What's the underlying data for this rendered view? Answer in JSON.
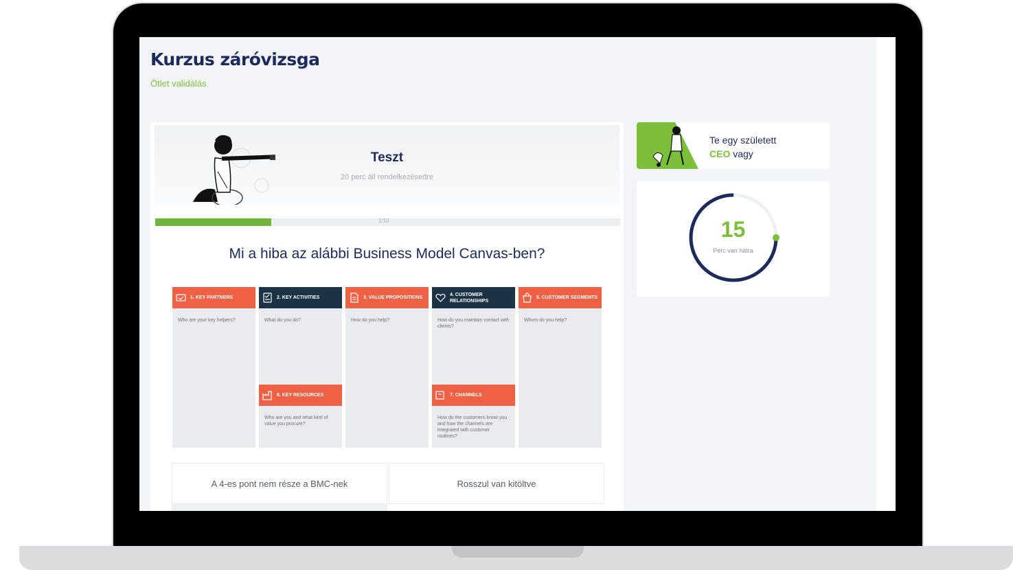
{
  "page": {
    "title": "Kurzus záróvizsga",
    "subtitle": "Ötlet validálás"
  },
  "quiz": {
    "name": "Teszt",
    "time": "20 perc áll rendelkezésedre",
    "progress_label": "1/10",
    "progress_fraction": 0.25,
    "question": "Mi a hiba az alábbi Business Model Canvas-ben?"
  },
  "bmc": {
    "columns": [
      {
        "title": "1. KEY PARTNERS",
        "prompt": "Who are your key helpers?"
      },
      {
        "title": "2. KEY ACTIVITIES",
        "prompt": "What do you do?"
      },
      {
        "title": "3. VALUE PROPOSITIONS",
        "prompt": "How do you help?"
      },
      {
        "title": "4. CUSTOMER RELATIONSHIPS",
        "prompt": "How do you maintain contact with clients?"
      },
      {
        "title": "5. CUSTOMER SEGMENTS",
        "prompt": "Whom do you help?"
      }
    ],
    "sub_blocks": [
      {
        "title": "6. KEY RESOURCES",
        "prompt": "Who are you and what kind of value you procure?"
      },
      {
        "title": "7. CHANNELS",
        "prompt": "How do the customers know you and how the channels are integrated with customer routines?"
      }
    ]
  },
  "answers": {
    "a": "A 4-es pont nem része a BMC-nek",
    "b": "Rosszul van kitöltve"
  },
  "ceo": {
    "line1": "Te egy született",
    "accent": "CEO",
    "line2": " vagy"
  },
  "timer": {
    "value": "15",
    "label": "Perc van hátra",
    "remaining_fraction": 0.75
  },
  "colors": {
    "navy": "#1c2a5c",
    "green": "#7cbf3a",
    "orange": "#ee6145",
    "dark_teal": "#1c3346"
  }
}
